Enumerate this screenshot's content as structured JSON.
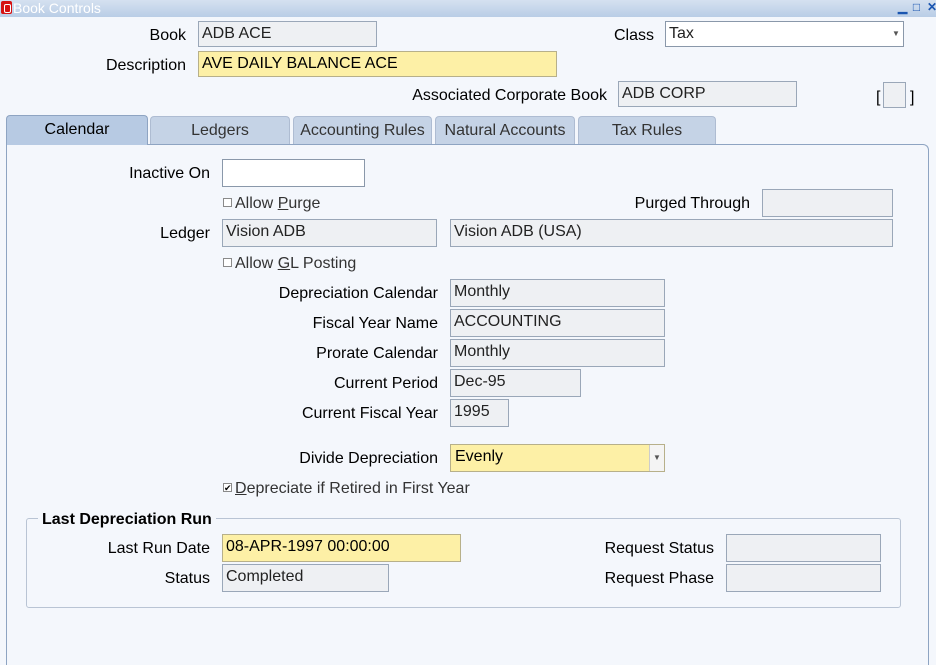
{
  "window": {
    "title": "Book Controls"
  },
  "header": {
    "book_label": "Book",
    "book_value": "ADB ACE",
    "class_label": "Class",
    "class_value": "Tax",
    "description_label": "Description",
    "description_value": "AVE DAILY BALANCE ACE",
    "assoc_label": "Associated Corporate Book",
    "assoc_value": "ADB CORP",
    "bracket_open": "[",
    "bracket_close": "]"
  },
  "tabs": [
    "Calendar",
    "Ledgers",
    "Accounting Rules",
    "Natural Accounts",
    "Tax Rules"
  ],
  "calendar": {
    "inactive_on_label": "Inactive On",
    "inactive_on_value": "",
    "allow_purge_pre": "Allow ",
    "allow_purge_u": "P",
    "allow_purge_post": "urge",
    "purged_through_label": "Purged Through",
    "purged_through_value": "",
    "ledger_label": "Ledger",
    "ledger_value": "Vision ADB",
    "ledger_desc": "Vision ADB (USA)",
    "allow_gl_pre": "Allow ",
    "allow_gl_u": "G",
    "allow_gl_post": "L Posting",
    "dep_cal_label": "Depreciation Calendar",
    "dep_cal_value": "Monthly",
    "fy_name_label": "Fiscal Year Name",
    "fy_name_value": "ACCOUNTING",
    "prorate_label": "Prorate Calendar",
    "prorate_value": "Monthly",
    "cur_period_label": "Current Period",
    "cur_period_value": "Dec-95",
    "cur_fy_label": "Current Fiscal Year",
    "cur_fy_value": "1995",
    "divide_label": "Divide Depreciation",
    "divide_value": "Evenly",
    "dep_retired_u": "D",
    "dep_retired_post": "epreciate if Retired in First Year",
    "dep_retired_check": "✔"
  },
  "last_run": {
    "title": "Last Depreciation Run",
    "date_label": "Last Run Date",
    "date_value": "08-APR-1997 00:00:00",
    "status_label": "Status",
    "status_value": "Completed",
    "req_status_label": "Request Status",
    "req_status_value": "",
    "req_phase_label": "Request Phase",
    "req_phase_value": ""
  },
  "colors": {
    "required": "#fdf0a6",
    "tab_active": "#b7cae3",
    "tab": "#c5d3e6"
  }
}
